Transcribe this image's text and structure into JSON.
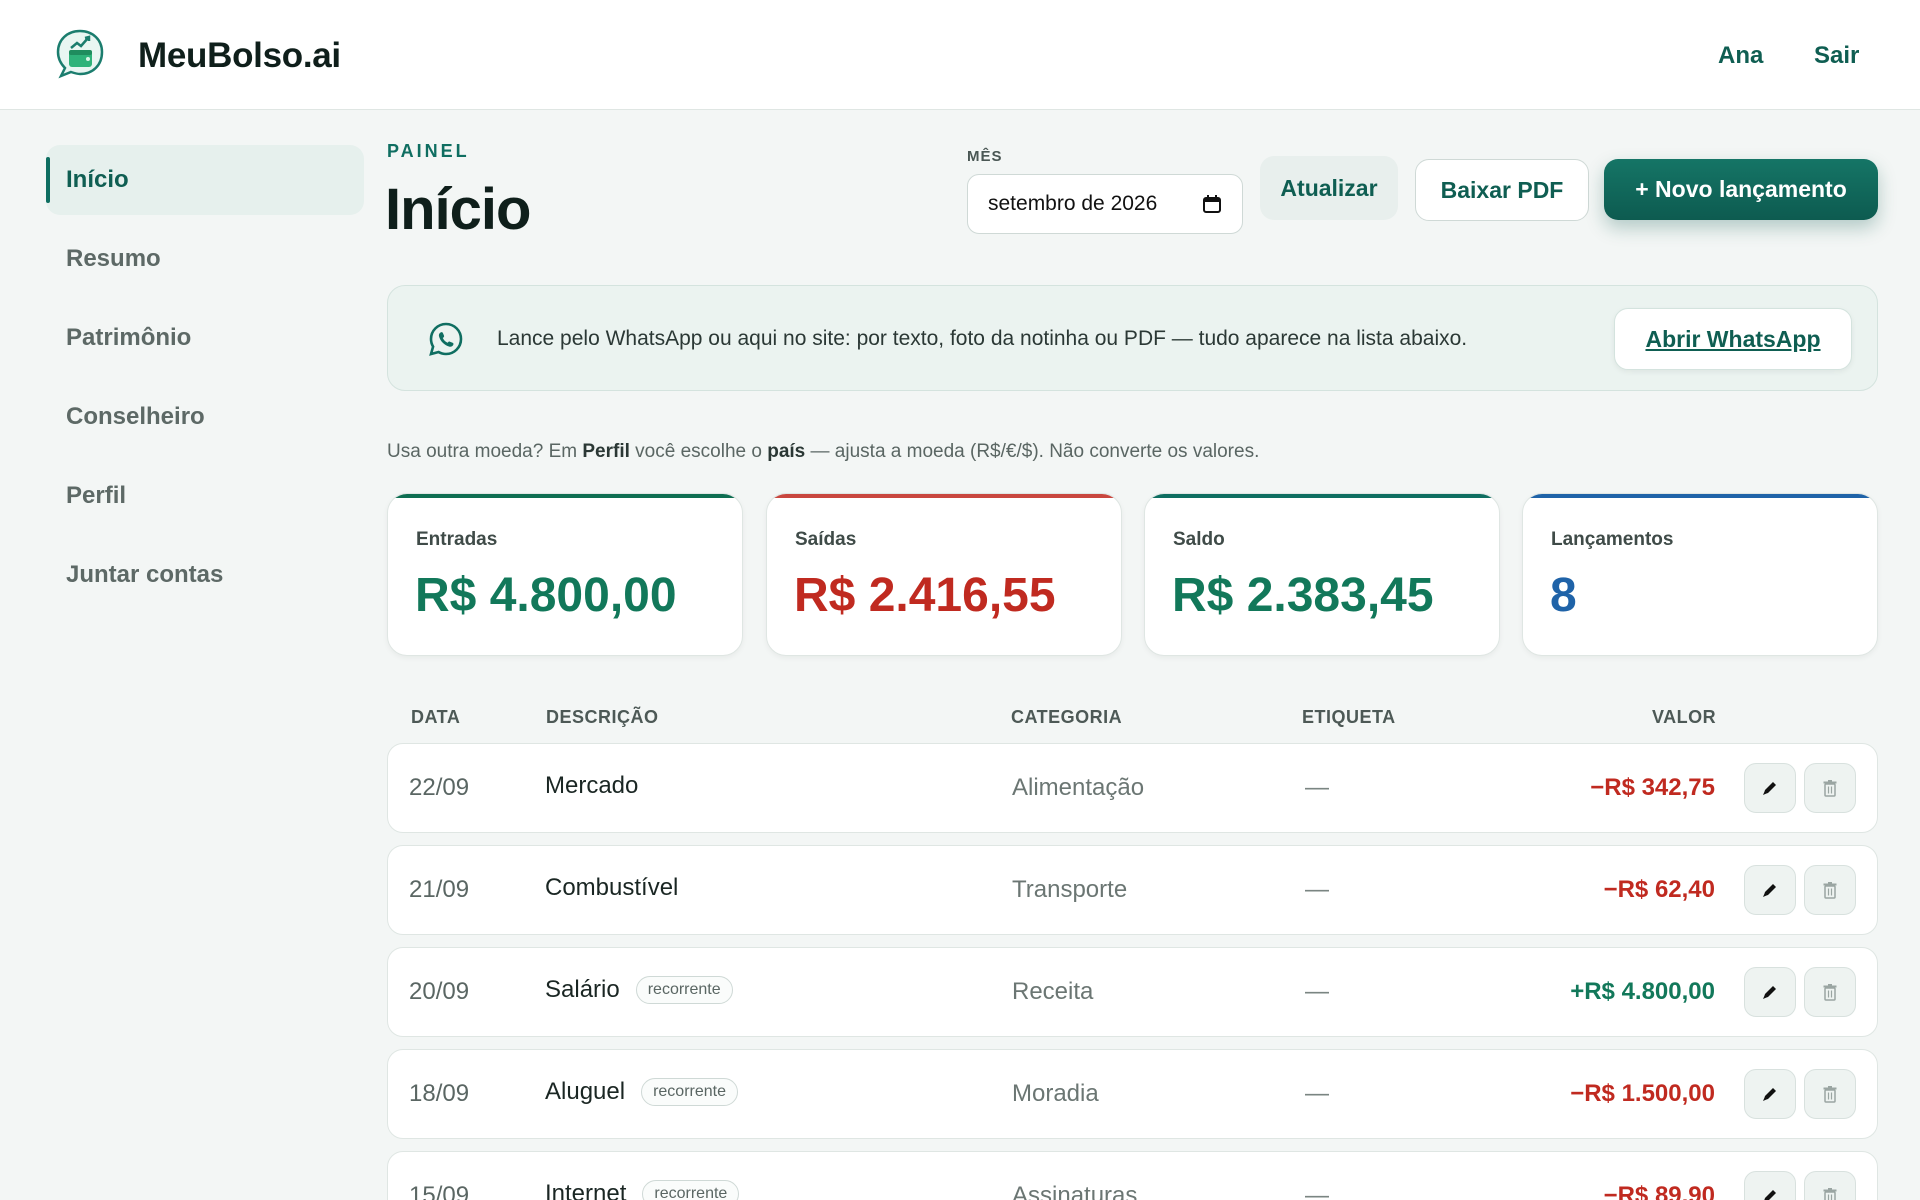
{
  "header": {
    "brand": "MeuBolso.ai",
    "user": "Ana",
    "logout": "Sair"
  },
  "sidebar": {
    "items": [
      {
        "label": "Início",
        "active": true
      },
      {
        "label": "Resumo"
      },
      {
        "label": "Patrimônio"
      },
      {
        "label": "Conselheiro"
      },
      {
        "label": "Perfil"
      },
      {
        "label": "Juntar contas"
      }
    ]
  },
  "page": {
    "eyebrow": "PAINEL",
    "title": "Início",
    "month_label": "MÊS",
    "month_value": "setembro de 2026",
    "refresh_label": "Atualizar",
    "pdf_label": "Baixar PDF",
    "new_label": "+ Novo lançamento"
  },
  "banner": {
    "text": "Lance pelo WhatsApp ou aqui no site: por texto, foto da notinha ou PDF — tudo aparece na lista abaixo.",
    "button": "Abrir WhatsApp"
  },
  "hint": {
    "part1": "Usa outra moeda? Em ",
    "bold1": "Perfil",
    "part2": " você escolhe o ",
    "bold2": "país",
    "part3": " — ajusta a moeda (R$/€/$). Não converte os valores."
  },
  "stats": [
    {
      "label": "Entradas",
      "value": "R$ 4.800,00",
      "color": "#12785a"
    },
    {
      "label": "Saídas",
      "value": "R$ 2.416,55",
      "color": "#c02a20"
    },
    {
      "label": "Saldo",
      "value": "R$ 2.383,45",
      "color": "#12785a"
    },
    {
      "label": "Lançamentos",
      "value": "8",
      "color": "#1f63a8"
    }
  ],
  "table": {
    "headers": {
      "date": "DATA",
      "desc": "DESCRIÇÃO",
      "cat": "CATEGORIA",
      "tag": "ETIQUETA",
      "value": "VALOR"
    },
    "rows": [
      {
        "date": "22/09",
        "desc": "Mercado",
        "badge": "",
        "cat": "Alimentação",
        "tag": "—",
        "value": "−R$ 342,75",
        "type": "out"
      },
      {
        "date": "21/09",
        "desc": "Combustível",
        "badge": "",
        "cat": "Transporte",
        "tag": "—",
        "value": "−R$ 62,40",
        "type": "out"
      },
      {
        "date": "20/09",
        "desc": "Salário",
        "badge": "recorrente",
        "cat": "Receita",
        "tag": "—",
        "value": "+R$ 4.800,00",
        "type": "in"
      },
      {
        "date": "18/09",
        "desc": "Aluguel",
        "badge": "recorrente",
        "cat": "Moradia",
        "tag": "—",
        "value": "−R$ 1.500,00",
        "type": "out"
      },
      {
        "date": "15/09",
        "desc": "Internet",
        "badge": "recorrente",
        "cat": "Assinaturas",
        "tag": "—",
        "value": "−R$ 89,90",
        "type": "out"
      }
    ]
  },
  "icons": {
    "logo": "wallet-chart-chat-icon",
    "whatsapp": "whatsapp-icon",
    "calendar": "calendar-icon",
    "edit": "pencil-icon",
    "delete": "trash-icon"
  },
  "colors": {
    "accent": "#0f5e52",
    "income": "#12785a",
    "expense": "#c02a20",
    "count": "#1f63a8"
  }
}
